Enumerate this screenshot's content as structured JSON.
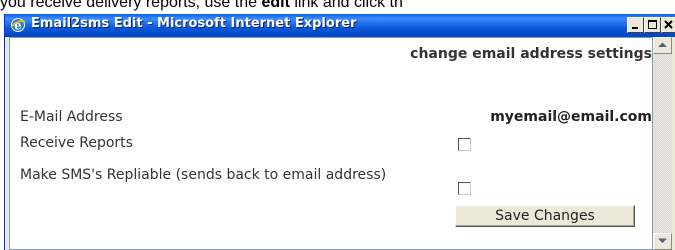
{
  "context_text": {
    "before": "you receive delivery reports, use the ",
    "bold": "edit",
    "after": " link and click th"
  },
  "window": {
    "title": "Email2sms Edit - Microsoft Internet Explorer",
    "icon": "ie-icon",
    "controls": [
      "minimize-icon",
      "maximize-icon",
      "close-icon"
    ]
  },
  "page": {
    "header": "change email address settings",
    "fields": {
      "email_label": "E-Mail Address",
      "email_value": "myemail@email.com",
      "reports_label": "Receive Reports",
      "reports_checked": false,
      "sms_label": "Make SMS's Repliable (sends back to email address)",
      "sms_checked": false
    },
    "save_button": "Save Changes"
  },
  "colors": {
    "titlebar": "#0a5fe8",
    "window_frame": "#ece9d8"
  }
}
